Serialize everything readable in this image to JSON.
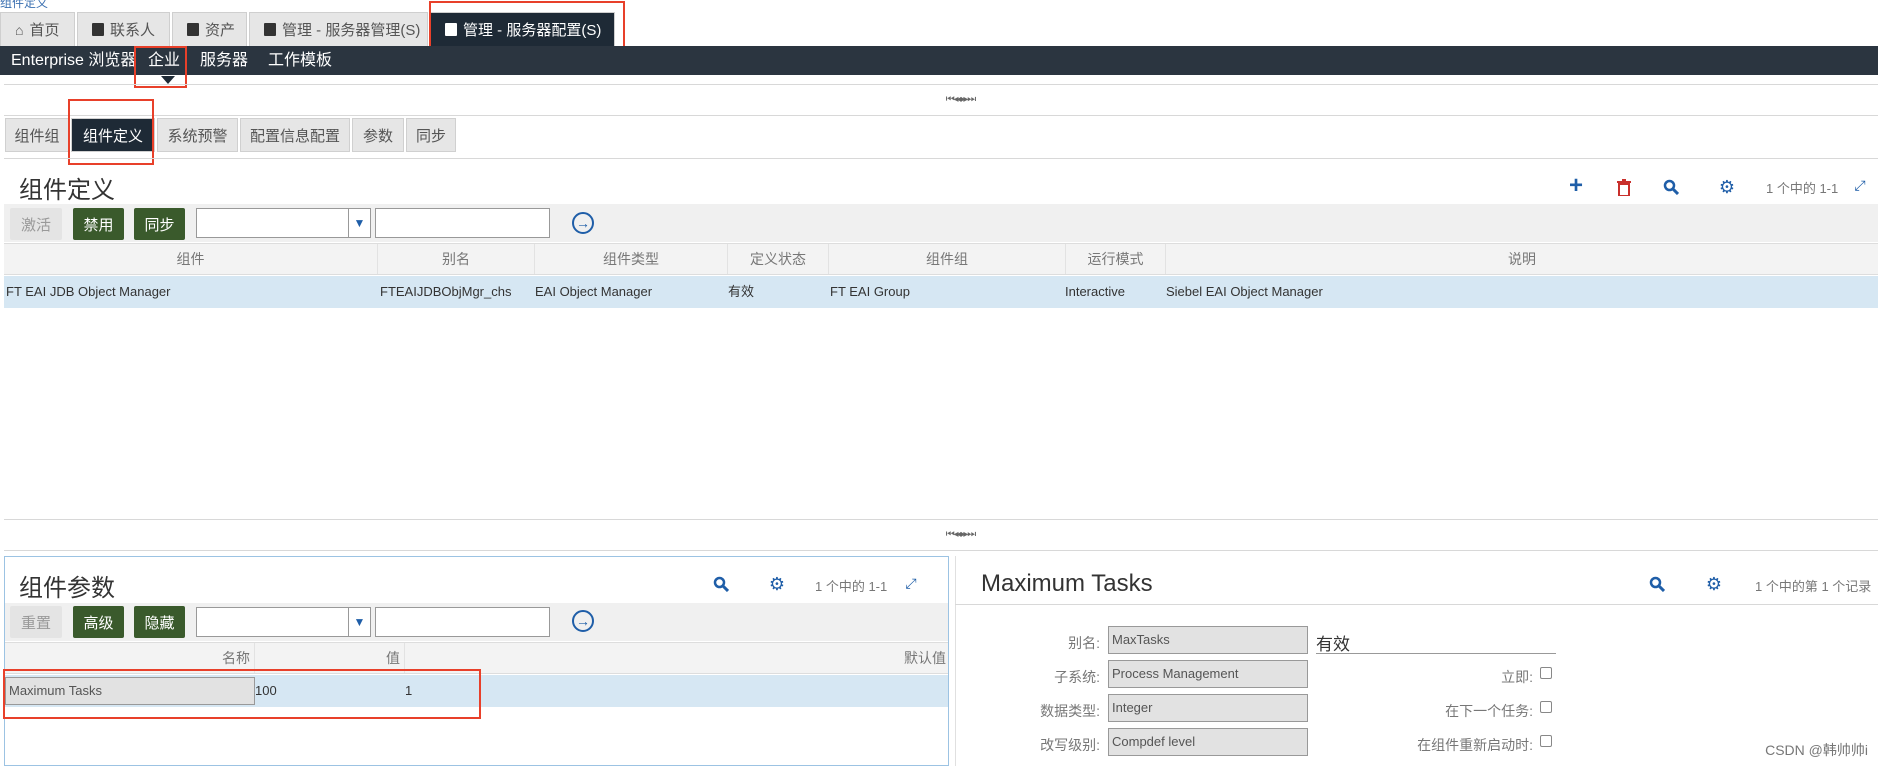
{
  "crumb": "组件定义",
  "top_tabs": [
    "首页",
    "联系人",
    "资产",
    "管理 - 服务器管理(S)",
    "管理 - 服务器配置(S)"
  ],
  "menu": [
    "Enterprise 浏览器",
    "企业",
    "服务器",
    "工作模板"
  ],
  "pager_symbols": "⏮ ◂◂ ▸▸ ⏭",
  "sub_tabs": [
    "组件组",
    "组件定义",
    "系统预警",
    "配置信息配置",
    "参数",
    "同步"
  ],
  "definitions": {
    "title": "组件定义",
    "count": "1 个中的 1-1",
    "buttons": {
      "activate": "激活",
      "disable": "禁用",
      "sync": "同步"
    },
    "columns": [
      "组件",
      "别名",
      "组件类型",
      "定义状态",
      "组件组",
      "运行模式",
      "说明"
    ],
    "rows": [
      [
        "FT EAI JDB Object Manager",
        "FTEAIJDBObjMgr_chs",
        "EAI Object Manager",
        "有效",
        "FT EAI Group",
        "Interactive",
        "Siebel EAI Object Manager"
      ]
    ]
  },
  "params": {
    "title": "组件参数",
    "count": "1 个中的 1-1",
    "buttons": {
      "reset": "重置",
      "advanced": "高级",
      "hide": "隐藏"
    },
    "columns": [
      "名称",
      "值",
      "默认值"
    ],
    "rows": [
      [
        "Maximum Tasks",
        "100",
        "1"
      ]
    ]
  },
  "detail": {
    "title": "Maximum Tasks",
    "count": "1 个中的第 1 个记录",
    "fields": [
      {
        "label": "别名:",
        "value": "MaxTasks"
      },
      {
        "label": "子系统:",
        "value": "Process Management"
      },
      {
        "label": "数据类型:",
        "value": "Integer"
      },
      {
        "label": "改写级别:",
        "value": "Compdef level"
      }
    ],
    "status_value": "有效",
    "checks": [
      "立即:",
      "在下一个任务:",
      "在组件重新启动时:"
    ]
  },
  "watermark": "CSDN @韩帅帅i",
  "colors": {
    "dark": "#1e2a36",
    "accent": "#1f5ea8",
    "green_btn": "#3a5a2c",
    "highlight": "#e8402a",
    "row_selected": "#d6e7f3"
  }
}
